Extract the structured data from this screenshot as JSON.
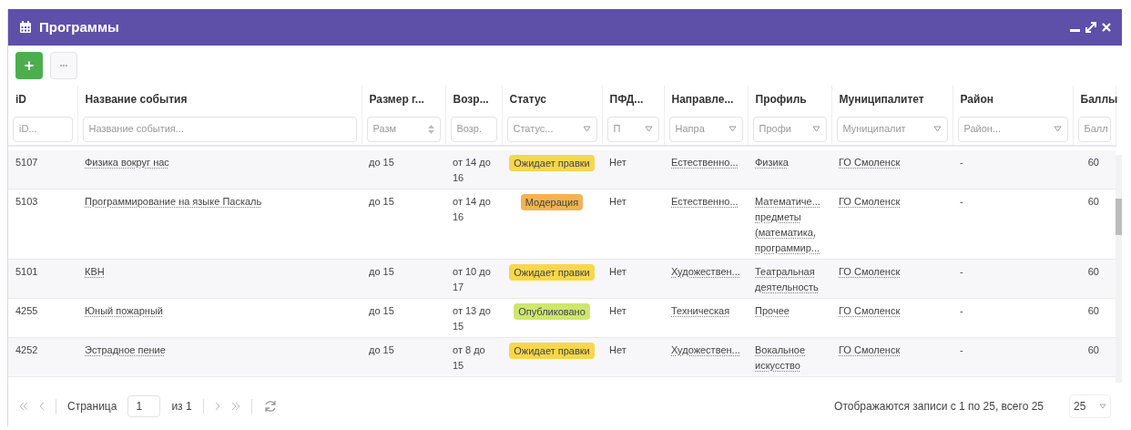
{
  "window": {
    "title": "Программы"
  },
  "toolbar": {
    "add_button": "+",
    "more_button": "•••"
  },
  "columns": [
    {
      "title": "iD",
      "kind": "text",
      "filter": {
        "kind": "text",
        "placeholder": "iD..."
      }
    },
    {
      "title": "Название события",
      "kind": "link",
      "filter": {
        "kind": "text",
        "placeholder": "Название события..."
      }
    },
    {
      "title": "Размер г...",
      "kind": "text",
      "filter": {
        "kind": "number",
        "placeholder": "Разм"
      }
    },
    {
      "title": "Возр...",
      "kind": "text",
      "filter": {
        "kind": "text",
        "placeholder": "Возр."
      }
    },
    {
      "title": "Статус",
      "kind": "status",
      "filter": {
        "kind": "select",
        "placeholder": "Статус..."
      }
    },
    {
      "title": "ПФД...",
      "kind": "text",
      "filter": {
        "kind": "select",
        "placeholder": "П"
      }
    },
    {
      "title": "Направле...",
      "kind": "link",
      "filter": {
        "kind": "select",
        "placeholder": "Напра"
      }
    },
    {
      "title": "Профиль",
      "kind": "link",
      "filter": {
        "kind": "select",
        "placeholder": "Профи"
      }
    },
    {
      "title": "Муниципалитет",
      "kind": "link",
      "filter": {
        "kind": "select",
        "placeholder": "Муниципалит"
      }
    },
    {
      "title": "Район",
      "kind": "text",
      "filter": {
        "kind": "select",
        "placeholder": "Район..."
      }
    },
    {
      "title": "Баллы",
      "kind": "text",
      "filter": {
        "kind": "text",
        "placeholder": "Балл"
      }
    }
  ],
  "rows": [
    {
      "cells": [
        "5107",
        "Физика вокруг нас",
        "до 15",
        "от 14 до 16",
        {
          "text": "Ожидает правки",
          "color": "#f8d64e"
        },
        "Нет",
        "Естественно...",
        "Физика",
        "ГО Смоленск",
        "-",
        "60"
      ]
    },
    {
      "cells": [
        "5103",
        "Программирование на языке Паскаль",
        "до 15",
        "от 14 до 16",
        {
          "text": "Модерация",
          "color": "#f2b352"
        },
        "Нет",
        "Естественно...",
        "Математиче... предметы (математика, программир...",
        "ГО Смоленск",
        "-",
        "60"
      ]
    },
    {
      "cells": [
        "5101",
        "КВН",
        "до 15",
        "от 10 до 17",
        {
          "text": "Ожидает правки",
          "color": "#f8d64e"
        },
        "Нет",
        "Художествен...",
        "Театральная деятельность",
        "ГО Смоленск",
        "-",
        "60"
      ]
    },
    {
      "cells": [
        "4255",
        "Юный пожарный",
        "до 15",
        "от 13 до 15",
        {
          "text": "Опубликовано",
          "color": "#cde76e"
        },
        "Нет",
        "Техническая",
        "Прочее",
        "ГО Смоленск",
        "-",
        "60"
      ]
    },
    {
      "cells": [
        "4252",
        "Эстрадное пение",
        "до 15",
        "от 8 до 15",
        {
          "text": "Ожидает правки",
          "color": "#f8d64e"
        },
        "Нет",
        "Художествен...",
        "Вокальное искусство",
        "ГО Смоленск",
        "-",
        "60"
      ]
    }
  ],
  "pager": {
    "page_label": "Страница",
    "page": "1",
    "of": "из 1",
    "summary": "Отображаются записи с 1 по 25, всего 25",
    "page_size": "25"
  }
}
